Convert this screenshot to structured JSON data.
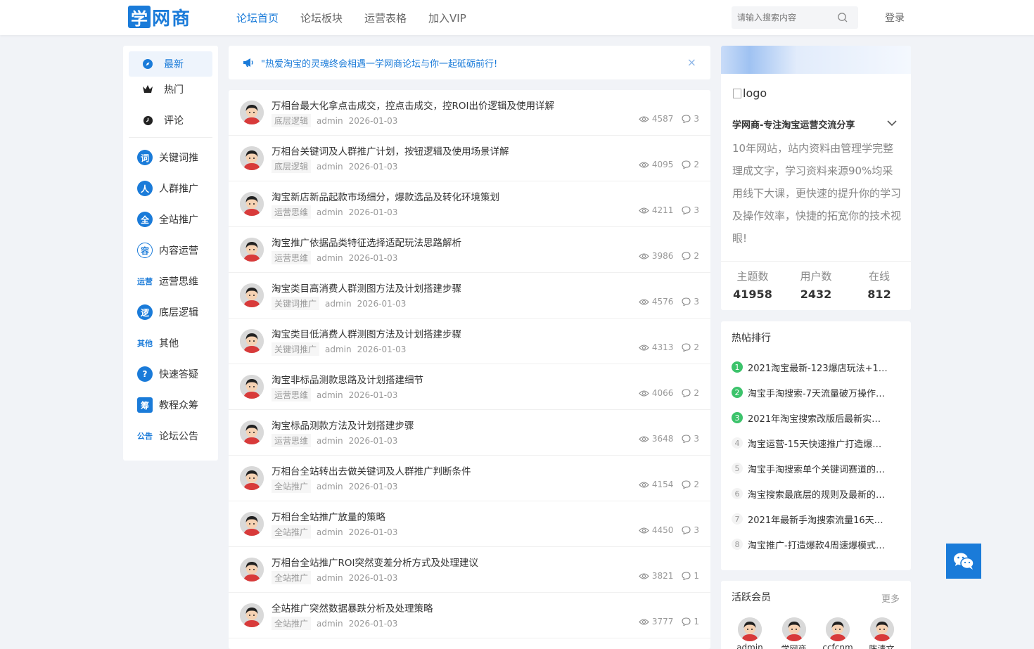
{
  "header": {
    "logo_box": "学",
    "logo_text": "网商",
    "nav": [
      "论坛首页",
      "论坛板块",
      "运营表格",
      "加入VIP"
    ],
    "search_placeholder": "请输入搜索内容",
    "login": "登录",
    "accent": "#1a7bd9"
  },
  "sidebar": {
    "tabs": [
      "最新",
      "热门",
      "评论"
    ],
    "categories": [
      {
        "label": "关键词推",
        "icon": "词"
      },
      {
        "label": "人群推广",
        "icon": "人"
      },
      {
        "label": "全站推广",
        "icon": "全"
      },
      {
        "label": "内容运营",
        "icon": "容"
      },
      {
        "label": "运营思维",
        "icon": "运营"
      },
      {
        "label": "底层逻辑",
        "icon": "逻"
      },
      {
        "label": "其他",
        "icon": "其他"
      },
      {
        "label": "快速答疑",
        "icon": "?"
      },
      {
        "label": "教程众筹",
        "icon": "筹"
      },
      {
        "label": "论坛公告",
        "icon": "公告"
      }
    ]
  },
  "notice": {
    "text": "\"热爱淘宝的灵魂终会相遇一学网商论坛与你一起砥砺前行!",
    "close": "×"
  },
  "posts": [
    {
      "title": "万相台最大化拿点击成交，控点击成交，控ROI出价逻辑及使用详解",
      "tag": "底层逻辑",
      "author": "admin",
      "date": "2026-01-03",
      "views": "4587",
      "comments": "3"
    },
    {
      "title": "万相台关键词及人群推广计划，按钮逻辑及使用场景详解",
      "tag": "底层逻辑",
      "author": "admin",
      "date": "2026-01-03",
      "views": "4095",
      "comments": "2"
    },
    {
      "title": "淘宝新店新品起款市场细分，爆款选品及转化环境策划",
      "tag": "运营思维",
      "author": "admin",
      "date": "2026-01-03",
      "views": "4211",
      "comments": "3"
    },
    {
      "title": "淘宝推广依据品类特征选择适配玩法思路解析",
      "tag": "运营思维",
      "author": "admin",
      "date": "2026-01-03",
      "views": "3986",
      "comments": "2"
    },
    {
      "title": "淘宝类目高消费人群测图方法及计划搭建步骤",
      "tag": "关键词推广",
      "author": "admin",
      "date": "2026-01-03",
      "views": "4576",
      "comments": "3"
    },
    {
      "title": "淘宝类目低消费人群测图方法及计划搭建步骤",
      "tag": "关键词推广",
      "author": "admin",
      "date": "2026-01-03",
      "views": "4313",
      "comments": "2"
    },
    {
      "title": "淘宝非标品测款思路及计划搭建细节",
      "tag": "运营思维",
      "author": "admin",
      "date": "2026-01-03",
      "views": "4066",
      "comments": "2"
    },
    {
      "title": "淘宝标品测款方法及计划搭建步骤",
      "tag": "运营思维",
      "author": "admin",
      "date": "2026-01-03",
      "views": "3648",
      "comments": "3"
    },
    {
      "title": "万相台全站转出去做关键词及人群推广判断条件",
      "tag": "全站推广",
      "author": "admin",
      "date": "2026-01-03",
      "views": "4154",
      "comments": "2"
    },
    {
      "title": "万相台全站推广放量的策略",
      "tag": "全站推广",
      "author": "admin",
      "date": "2026-01-03",
      "views": "4450",
      "comments": "3"
    },
    {
      "title": "万相台全站推广ROI突然变差分析方式及处理建议",
      "tag": "全站推广",
      "author": "admin",
      "date": "2026-01-03",
      "views": "3821",
      "comments": "1"
    },
    {
      "title": "全站推广突然数据暴跌分析及处理策略",
      "tag": "全站推广",
      "author": "admin",
      "date": "2026-01-03",
      "views": "3777",
      "comments": "1"
    }
  ],
  "profile": {
    "logo_alt": "logo",
    "name": "学网商-专注淘宝运营交流分享",
    "description": "10年网站，站内资料由管理学完整理成文字，学习资料来源90%均采用线下大课，更快速的提升你的学习及操作效率，快捷的拓宽你的技术视眼!",
    "stats": [
      {
        "label": "主题数",
        "value": "41958"
      },
      {
        "label": "用户数",
        "value": "2432"
      },
      {
        "label": "在线",
        "value": "812"
      }
    ]
  },
  "hot": {
    "title": "热帖排行",
    "items": [
      {
        "num": "1",
        "text": "2021淘宝最新-123爆店玩法+1…"
      },
      {
        "num": "2",
        "text": "淘宝手淘搜索-7天流量破万操作…"
      },
      {
        "num": "3",
        "text": "2021年淘宝搜索改版后最新实…"
      },
      {
        "num": "4",
        "text": "淘宝运营-15天快速推广打造爆…"
      },
      {
        "num": "5",
        "text": "淘宝手淘搜索单个关键词赛道的…"
      },
      {
        "num": "6",
        "text": "淘宝搜索最底层的规则及最新的…"
      },
      {
        "num": "7",
        "text": "2021年最新手淘搜索流量16天…"
      },
      {
        "num": "8",
        "text": "淘宝推广-打造爆款4周速爆模式…"
      }
    ]
  },
  "members": {
    "title": "活跃会员",
    "more": "更多",
    "list": [
      "admin",
      "学网商",
      "ccfcnm",
      "陈清文"
    ]
  }
}
